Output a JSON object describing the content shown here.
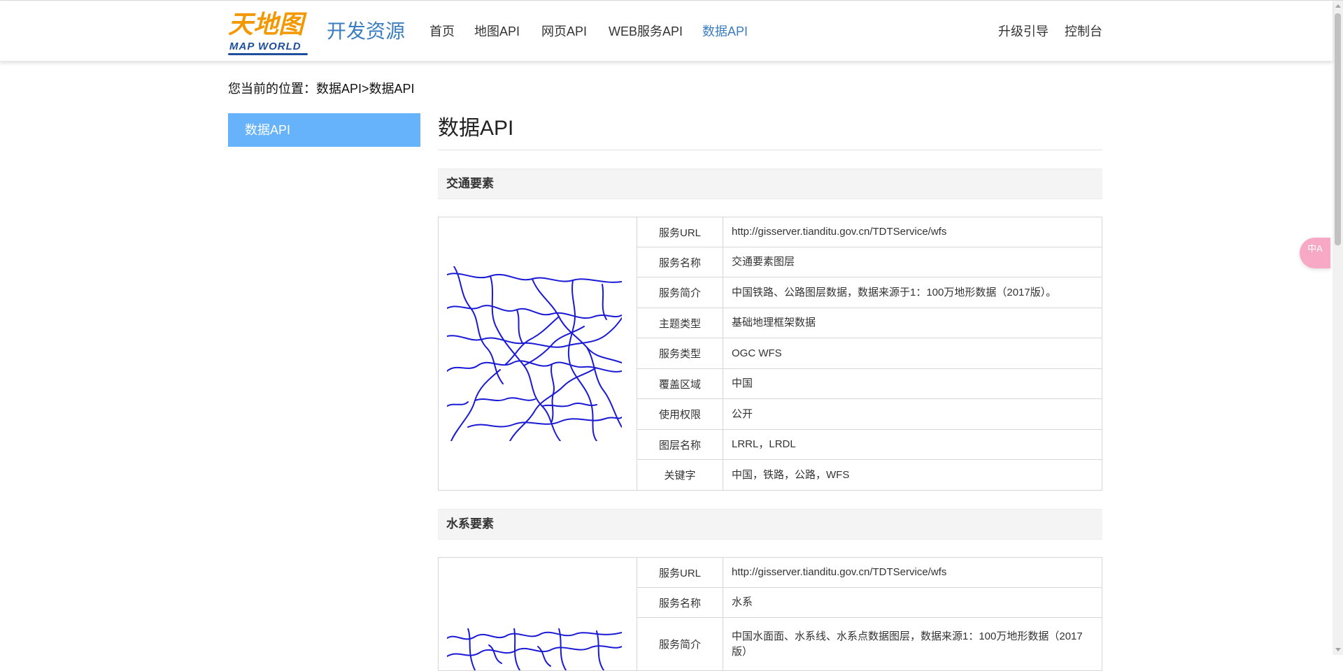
{
  "header": {
    "logo_cn": "天地图",
    "logo_en": "MAP WORLD",
    "site_name": "开发资源",
    "nav": [
      {
        "label": "首页"
      },
      {
        "label": "地图API"
      },
      {
        "label": "网页API"
      },
      {
        "label": "WEB服务API"
      },
      {
        "label": "数据API"
      }
    ],
    "right_nav": [
      {
        "label": "升级引导"
      },
      {
        "label": "控制台"
      }
    ],
    "active_color": "#3a7dc1"
  },
  "breadcrumb": "您当前的位置：数据API>数据API",
  "sidebar": {
    "items": [
      {
        "label": "数据API"
      }
    ],
    "active_bg": "#66b2fb"
  },
  "main": {
    "title": "数据API",
    "sections": [
      {
        "heading": "交通要素",
        "rows": [
          {
            "key": "服务URL",
            "value": "http://gisserver.tianditu.gov.cn/TDTService/wfs"
          },
          {
            "key": "服务名称",
            "value": "交通要素图层"
          },
          {
            "key": "服务简介",
            "value": "中国铁路、公路图层数据，数据来源于1：100万地形数据（2017版）。"
          },
          {
            "key": "主题类型",
            "value": "基础地理框架数据"
          },
          {
            "key": "服务类型",
            "value": "OGC WFS"
          },
          {
            "key": "覆盖区域",
            "value": "中国"
          },
          {
            "key": "使用权限",
            "value": "公开"
          },
          {
            "key": "图层名称",
            "value": "LRRL，LRDL"
          },
          {
            "key": "关键字",
            "value": "中国，铁路，公路，WFS"
          }
        ]
      },
      {
        "heading": "水系要素",
        "rows": [
          {
            "key": "服务URL",
            "value": "http://gisserver.tianditu.gov.cn/TDTService/wfs"
          },
          {
            "key": "服务名称",
            "value": "水系"
          },
          {
            "key": "服务简介",
            "value": "中国水面面、水系线、水系点数据图层，数据来源1：100万地形数据（2017版）"
          }
        ]
      }
    ]
  },
  "translate_button": {
    "label": "中A",
    "icon": "translate-icon"
  },
  "map_line_color": "#1a1ad6"
}
